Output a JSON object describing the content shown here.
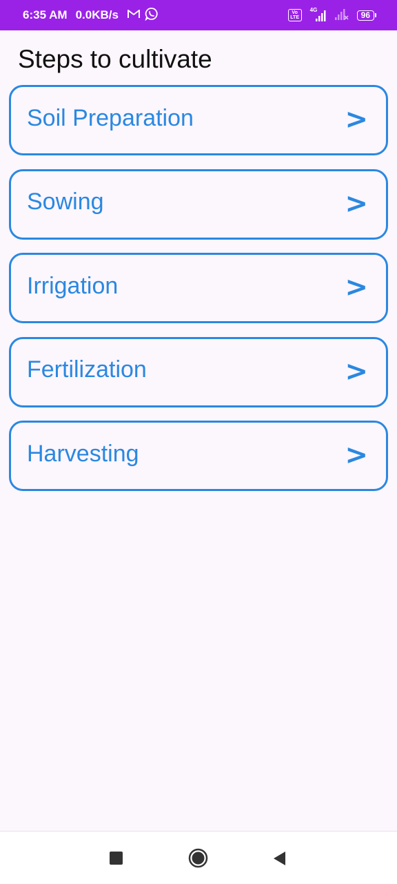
{
  "status_bar": {
    "time": "6:35 AM",
    "speed": "0.0KB/s",
    "volte": "Vo LTE",
    "network": "4G",
    "battery": "96",
    "icons": [
      "gmail-icon",
      "whatsapp-icon",
      "volte-icon",
      "signal-icon",
      "signal-weak-icon",
      "battery-icon"
    ]
  },
  "page": {
    "title": "Steps to cultivate"
  },
  "steps": [
    {
      "label": "Soil Preparation",
      "arrow": ">"
    },
    {
      "label": "Sowing",
      "arrow": ">"
    },
    {
      "label": "Irrigation",
      "arrow": ">"
    },
    {
      "label": "Fertilization",
      "arrow": ">"
    },
    {
      "label": "Harvesting",
      "arrow": ">"
    }
  ],
  "nav_bar": {
    "buttons": [
      "recents-button",
      "home-button",
      "back-button"
    ]
  },
  "colors": {
    "status_bar_bg": "#9a22e6",
    "accent": "#2a88e0",
    "page_bg": "#fcf6fd",
    "title_text": "#111111"
  }
}
